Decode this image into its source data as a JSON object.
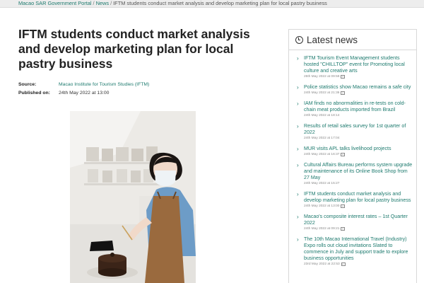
{
  "breadcrumb": {
    "items": [
      "Macao SAR Government Portal",
      "News"
    ],
    "separator": "/",
    "current": "IFTM students conduct market analysis and develop marketing plan for local pastry business"
  },
  "article": {
    "title": "IFTM students conduct market analysis and develop marketing plan for local pastry business",
    "source_label": "Source:",
    "source_value": "Macao Institute for Tourism Studies (IFTM)",
    "published_label": "Published on:",
    "published_value": "24th May 2022 at 13:00"
  },
  "sidebar": {
    "title": "Latest news",
    "icon": "clock-icon",
    "items": [
      {
        "title": "IFTM Tourism Event Management students hosted \"CHILLTOP\" event for Promoting local culture and creative arts",
        "date": "25th May 2022 at 09:59"
      },
      {
        "title": "Police statistics show Macao remains a safe city",
        "date": "24th May 2022 at 21:36"
      },
      {
        "title": "IAM finds no abnormalities in re-tests on cold-chain meat products imported from Brazil",
        "date": "24th May 2022 at 18:14"
      },
      {
        "title": "Results of retail sales survey for 1st quarter of 2022",
        "date": "24th May 2022 at 17:04"
      },
      {
        "title": "MUR visits APL talks livelihood projects",
        "date": "24th May 2022 at 16:37"
      },
      {
        "title": "Cultural Affairs Bureau performs system upgrade and maintenance of its Online Book Shop from 27 May",
        "date": "24th May 2022 at 15:27"
      },
      {
        "title": "IFTM students conduct market analysis and develop marketing plan for local pastry business",
        "date": "24th May 2022 at 13:00"
      },
      {
        "title": "Macao's composite interest rates – 1st Quarter 2022",
        "date": "24th May 2022 at 09:21"
      },
      {
        "title": "The 10th Macao International Travel (Industry) Expo rolls out cloud invitations Slated to commence in July and support trade to explore business opportunities",
        "date": "23rd May 2022 at 22:53"
      }
    ]
  },
  "colors": {
    "link": "#1d7a6e",
    "apron": "#9a6a3e",
    "shirt": "#6d9cc7",
    "mask": "#eef3f6",
    "cake": "#3b2418"
  }
}
